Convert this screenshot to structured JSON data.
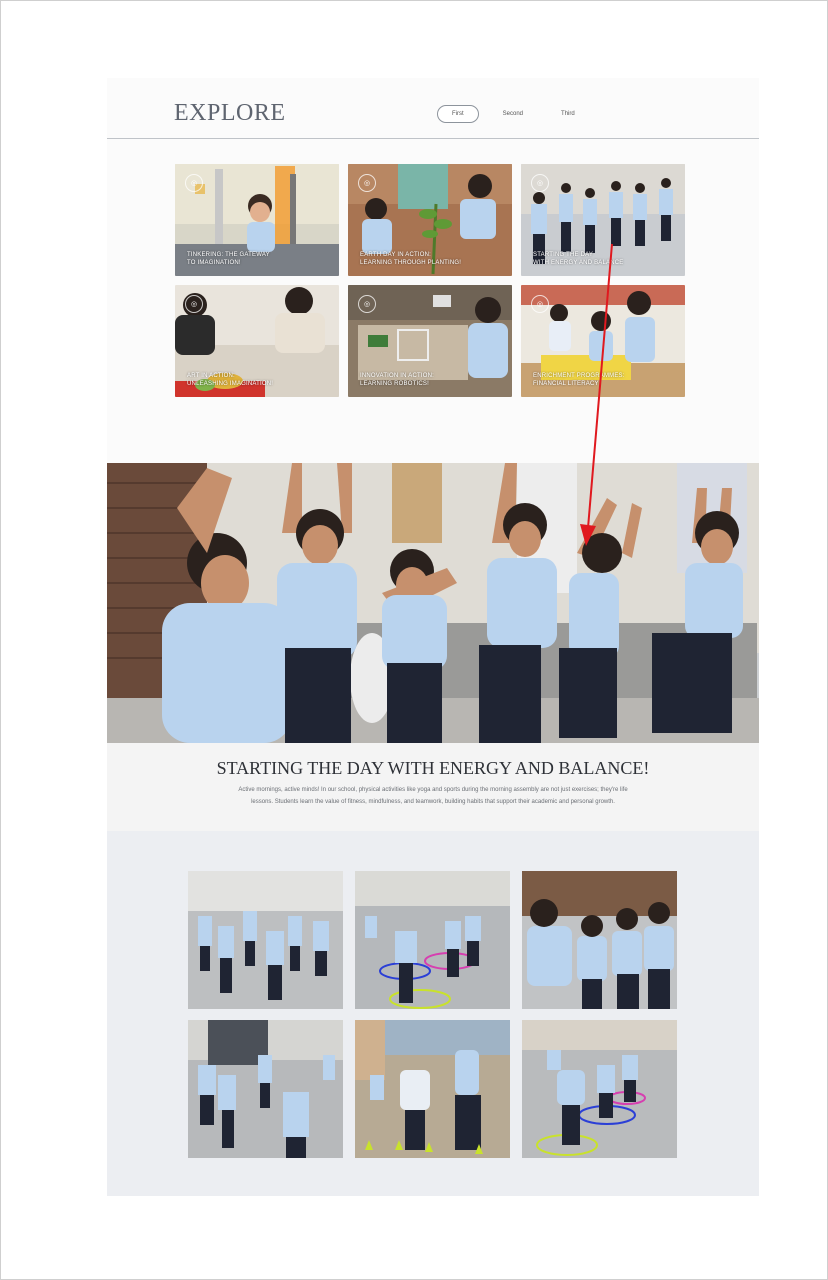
{
  "brand": "EXPLORE",
  "tabs": [
    {
      "label": "First",
      "active": true
    },
    {
      "label": "Second",
      "active": false
    },
    {
      "label": "Third",
      "active": false
    }
  ],
  "cards": [
    {
      "line1": "TINKERING: THE GATEWAY",
      "line2": "TO IMAGINATION!",
      "scene": "lab"
    },
    {
      "line1": "EARTH DAY IN ACTION:",
      "line2": "LEARNING THROUGH PLANTING!",
      "scene": "planting"
    },
    {
      "line1": "STARTING THE DAY",
      "line2": "WITH ENERGY AND BALANCE",
      "scene": "yoga"
    },
    {
      "line1": "ART IN ACTION:",
      "line2": "UNLEASHING IMAGINATION!",
      "scene": "art"
    },
    {
      "line1": "INNOVATION IN ACTION:",
      "line2": "LEARNING ROBOTICS!",
      "scene": "robotics"
    },
    {
      "line1": "ENRICHMENT PROGRAMMES:",
      "line2": "FINANCIAL LITERACY",
      "scene": "finance"
    }
  ],
  "story": {
    "title": "STARTING THE DAY WITH ENERGY AND BALANCE!",
    "body": "Active mornings, active minds! In our school, physical activities like yoga and sports during the morning assembly are not just exercises; they're life lessons. Students learn the value of fitness, mindfulness, and teamwork, building habits that support their academic and personal growth."
  },
  "colors": {
    "uniform_shirt": "#b9d3ee",
    "uniform_pants": "#1f2433",
    "annotation_arrow": "#e0191f",
    "gallery_bg": "#eceef2"
  },
  "icons": {
    "card_badge": "play-circle-icon"
  }
}
